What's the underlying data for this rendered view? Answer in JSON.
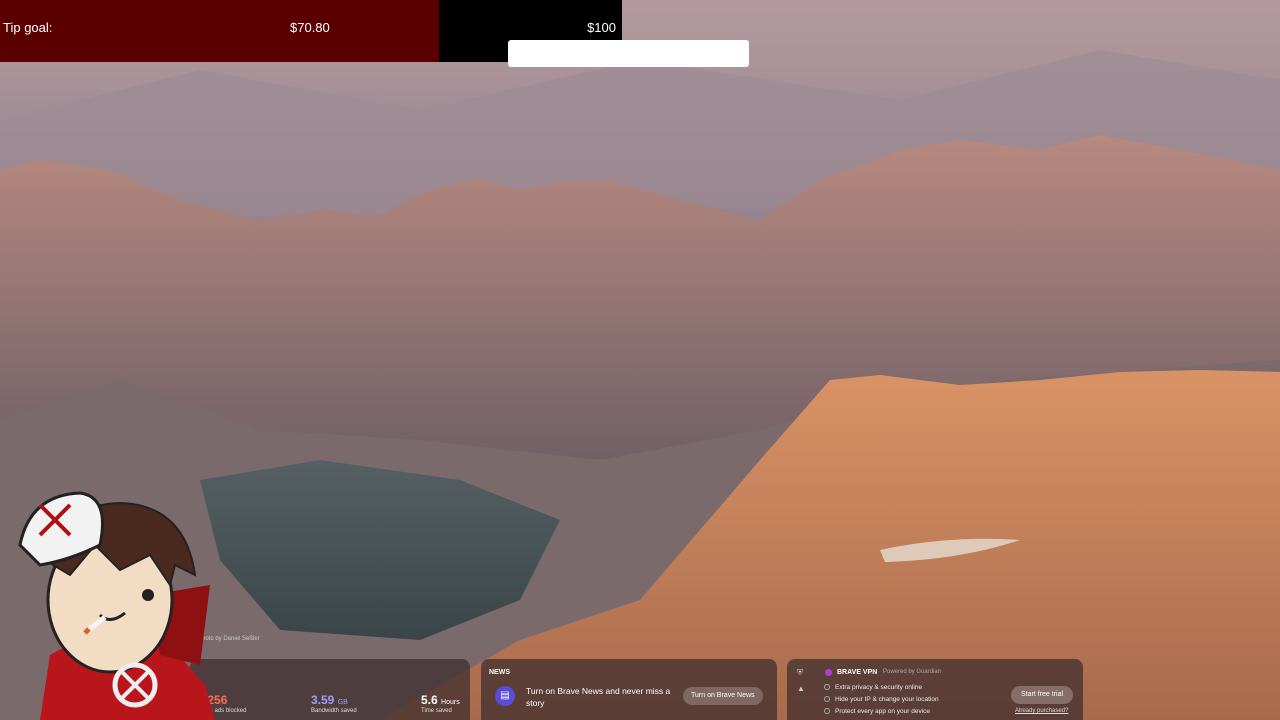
{
  "tip": {
    "label": "Tip goal:",
    "current": "$70.80",
    "target": "$100",
    "progress": 0.708
  },
  "background": {
    "credit": "Photo by Daniel Seßler"
  },
  "stats": {
    "trackers_value": "398,256",
    "trackers_label": "Trackers & ads blocked",
    "bandwidth_value": "3.59",
    "bandwidth_unit": "GB",
    "bandwidth_label": "Bandwidth saved",
    "time_value": "5.6",
    "time_unit": "Hours",
    "time_label": "Time saved"
  },
  "news": {
    "title": "NEWS",
    "text": "Turn on Brave News and never miss a story",
    "button": "Turn on Brave News",
    "icon": "news-icon"
  },
  "vpn": {
    "title": "BRAVE VPN",
    "powered": "Powered by Guardian",
    "features": [
      "Extra privacy & security online",
      "Hide your IP & change your location",
      "Protect every app on your device"
    ],
    "button": "Start free trial",
    "link": "Already purchased?"
  },
  "colors": {
    "tip_fill": "#5a0000",
    "trackers": "#ff6a55",
    "bandwidth": "#a79af5"
  }
}
